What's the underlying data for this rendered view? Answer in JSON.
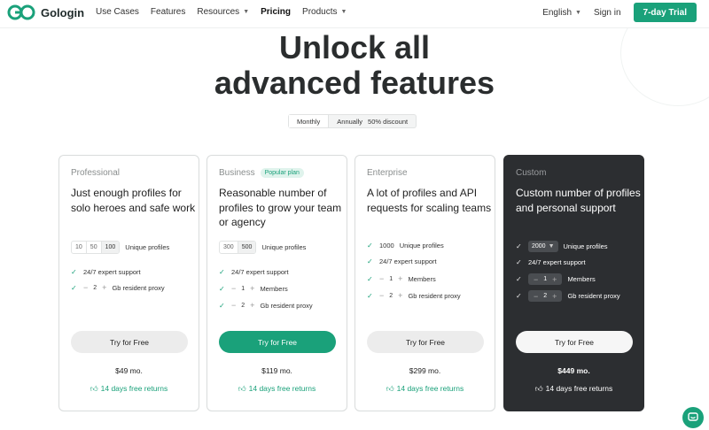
{
  "brand": {
    "name": "Gologin",
    "accent": "#1aa17a"
  },
  "nav": {
    "items": [
      {
        "label": "Use Cases",
        "dropdown": false
      },
      {
        "label": "Features",
        "dropdown": false
      },
      {
        "label": "Resources",
        "dropdown": true
      },
      {
        "label": "Pricing",
        "dropdown": false
      },
      {
        "label": "Products",
        "dropdown": true
      }
    ],
    "language": "English",
    "signin": "Sign in",
    "trial": "7-day Trial"
  },
  "hero": {
    "line1": "Unlock all",
    "line2": "advanced features"
  },
  "billing": {
    "monthly": "Monthly",
    "annually": "Annually",
    "discount": "50% discount"
  },
  "plans": [
    {
      "name": "Professional",
      "desc": "Just enough profiles for solo heroes and safe work",
      "profile_options": [
        "10",
        "50",
        "100"
      ],
      "profiles_label": "Unique profiles",
      "support": "24/7 expert support",
      "proxy_value": "2",
      "proxy_label": "Gb resident proxy",
      "cta": "Try for Free",
      "price": "$49 mo.",
      "returns": "14 days free returns"
    },
    {
      "name": "Business",
      "badge": "Popular plan",
      "desc": "Reasonable number of profiles to grow your team or agency",
      "profile_options": [
        "300",
        "500"
      ],
      "profiles_label": "Unique profiles",
      "support": "24/7 expert support",
      "members_value": "1",
      "members_label": "Members",
      "proxy_value": "2",
      "proxy_label": "Gb resident proxy",
      "cta": "Try for Free",
      "price": "$119 mo.",
      "returns": "14 days free returns"
    },
    {
      "name": "Enterprise",
      "desc": "A lot of profiles and API requests for scaling teams",
      "profiles_value": "1000",
      "profiles_label": "Unique profiles",
      "support": "24/7 expert support",
      "members_value": "1",
      "members_label": "Members",
      "proxy_value": "2",
      "proxy_label": "Gb resident proxy",
      "cta": "Try for Free",
      "price": "$299 mo.",
      "returns": "14 days free returns"
    },
    {
      "name": "Custom",
      "desc": "Custom number of profiles and personal support",
      "profiles_value": "2000",
      "profiles_label": "Unique profiles",
      "support": "24/7 expert support",
      "members_value": "1",
      "members_label": "Members",
      "proxy_value": "2",
      "proxy_label": "Gb resident proxy",
      "cta": "Try for Free",
      "price": "$449 mo.",
      "returns": "14 days free returns"
    }
  ]
}
